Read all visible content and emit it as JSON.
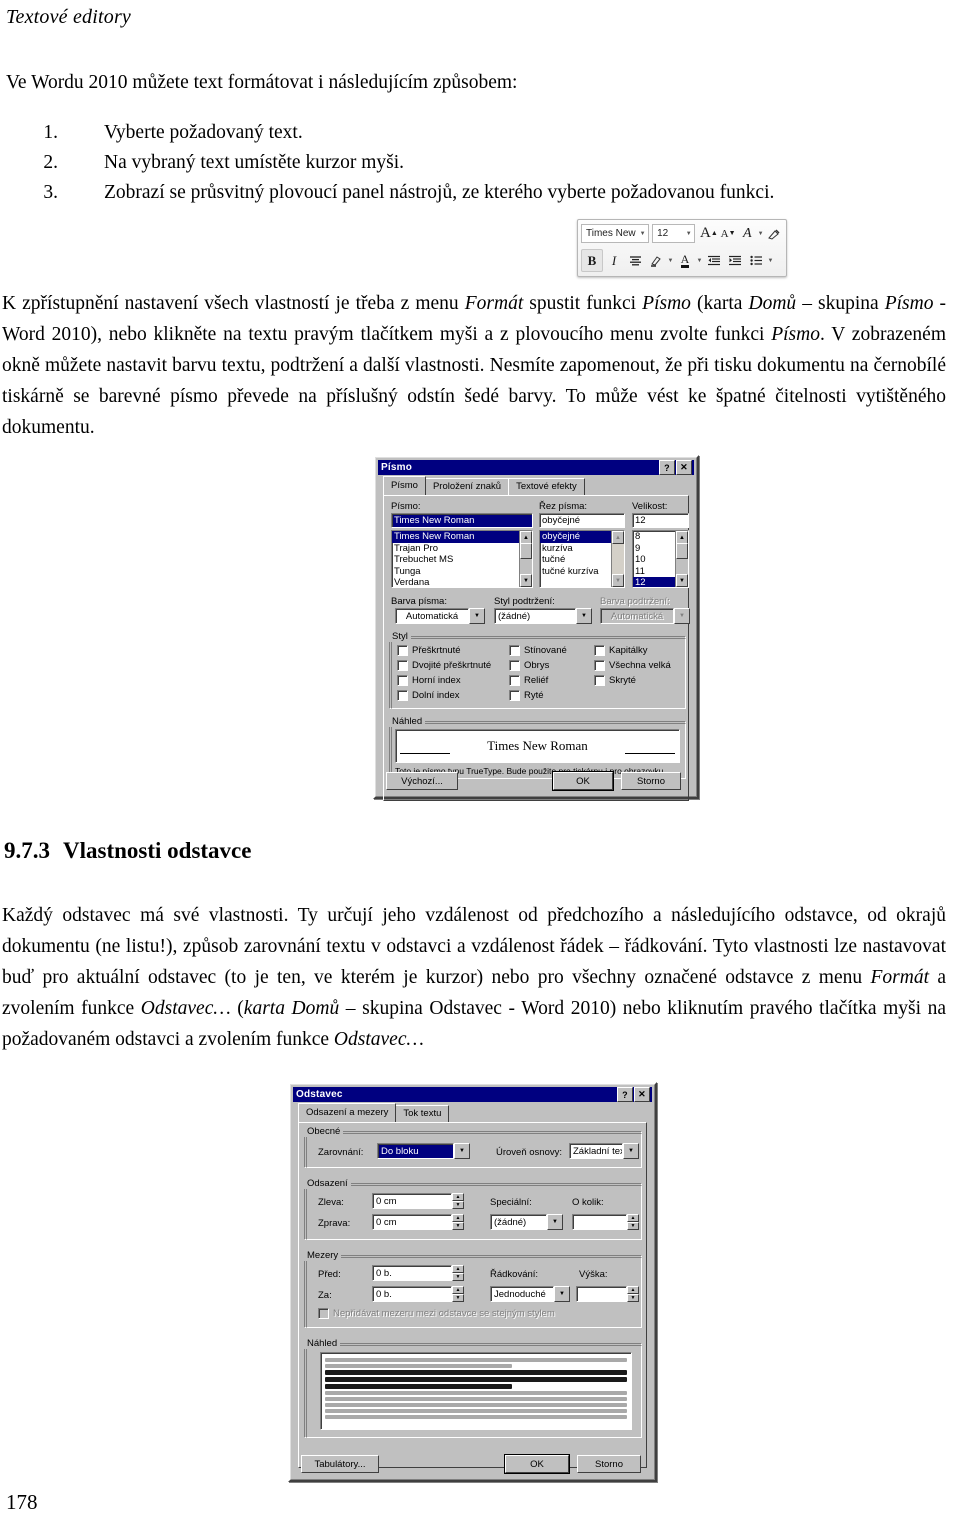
{
  "page": {
    "running_head": "Textové editory",
    "page_number": "178"
  },
  "body": {
    "intro": "Ve Wordu 2010 můžete text formátovat i následujícím způsobem:",
    "list": [
      {
        "num": "1.",
        "text": "Vyberte požadovaný text."
      },
      {
        "num": "2.",
        "text": "Na vybraný text umístěte kurzor myši."
      },
      {
        "num": "3.",
        "text": "Zobrazí se průsvitný plovoucí panel nástrojů, ze kterého vyberte požadovanou funkci."
      }
    ],
    "paragraph_font": {
      "s1": "K zpřístupnění nastavení všech vlastností je třeba z menu ",
      "i1": "Formát",
      "s2": " spustit funkci ",
      "i2": "Písmo",
      "s3": " (karta ",
      "i3": "Domů",
      "s4": " – skupina ",
      "i4": "Písmo",
      "s5": " - Word 2010), nebo klikněte na textu pravým tlačítkem myši a z plovoucího menu zvolte funkci ",
      "i5": "Písmo",
      "s6": ". V zobrazeném okně můžete nastavit barvu textu, podtržení a další vlastnosti. Nesmíte zapomenout, že při tisku dokumentu na černobílé tiskárně se barevné písmo převede na příslušný odstín šedé barvy. To může vést ke špatné čitelnosti vytištěného dokumentu."
    },
    "heading": {
      "number": "9.7.3",
      "title": "Vlastnosti odstavce"
    },
    "paragraph_para": {
      "s1": "Každý odstavec má své vlastnosti. Ty určují jeho vzdálenost od předchozího a následujícího odstavce, od okrajů dokumentu (ne listu!), způsob zarovnání textu v odstavci a vzdálenost řádek – řádkování. Tyto vlastnosti lze nastavovat buď pro aktuální odstavec (to je ten, ve kterém je kurzor) nebo pro všechny označené odstavce z menu ",
      "i1": "Formát",
      "s2": " a zvolením funkce ",
      "i2": "Odstavec…",
      "s3": " (",
      "i3": "karta Domů",
      "s4": " – skupina Odstavec - Word 2010) nebo kliknutím pravého tlačítka myši na požadovaném odstavci a zvolením funkce ",
      "i4": "Odstavec…",
      "s5": ""
    }
  },
  "minibar": {
    "font_name": "Times New",
    "font_size": "12",
    "grow_font_icon": "grow-font-icon",
    "shrink_font_icon": "shrink-font-icon",
    "clear_format_icon": "clear-formatting-icon",
    "format_painter_icon": "format-painter-icon",
    "bold": "B",
    "italic": "I",
    "align_icon": "center-align-icon",
    "highlight_icon": "highlight-icon",
    "font_color": "A",
    "decrease_indent_icon": "decrease-indent-icon",
    "increase_indent_icon": "increase-indent-icon",
    "bullets_icon": "bullets-icon",
    "dropdown_arrow": "▼"
  },
  "font_dialog": {
    "title": "Písmo",
    "help_button": "?",
    "close_button": "✕",
    "tabs": [
      {
        "label": "Písmo",
        "selected": true
      },
      {
        "label": "Proložení znaků",
        "selected": false
      },
      {
        "label": "Textové efekty",
        "selected": false
      }
    ],
    "font_label": "Písmo:",
    "font_value": "Times New Roman",
    "font_list": [
      "Times New Roman",
      "Trajan Pro",
      "Trebuchet MS",
      "Tunga",
      "Verdana"
    ],
    "style_label": "Řez písma:",
    "style_value": "obyčejné",
    "style_list": [
      "obyčejné",
      "kurzíva",
      "tučné",
      "tučné kurzíva"
    ],
    "size_label": "Velikost:",
    "size_value": "12",
    "size_list": [
      "8",
      "9",
      "10",
      "11",
      "12"
    ],
    "font_color_label": "Barva písma:",
    "font_color_value": "Automatická",
    "underline_style_label": "Styl podtržení:",
    "underline_style_value": "(žádné)",
    "underline_color_label": "Barva podtržení:",
    "underline_color_value": "Automatická",
    "effects_group": "Styl",
    "effects_col1": [
      "Přeškrtnuté",
      "Dvojité přeškrtnuté",
      "Horní index",
      "Dolní index"
    ],
    "effects_col2": [
      "Stínované",
      "Obrys",
      "Reliéf",
      "Ryté"
    ],
    "effects_col3": [
      "Kapitálky",
      "Všechna velká",
      "Skryté"
    ],
    "preview_group": "Náhled",
    "preview_text": "Times New Roman",
    "hint": "Toto je písmo typu TrueType. Bude použito pro tiskárnu i pro obrazovku.",
    "default_button": "Výchozí...",
    "ok_button": "OK",
    "cancel_button": "Storno"
  },
  "paragraph_dialog": {
    "title": "Odstavec",
    "help_button": "?",
    "close_button": "✕",
    "tabs": [
      {
        "label": "Odsazení a mezery",
        "selected": true
      },
      {
        "label": "Tok textu",
        "selected": false
      }
    ],
    "general_group": "Obecné",
    "alignment_label": "Zarovnání:",
    "alignment_value": "Do bloku",
    "outline_label": "Úroveň osnovy:",
    "outline_value": "Základní text",
    "indent_group": "Odsazení",
    "left_label": "Zleva:",
    "left_value": "0 cm",
    "right_label": "Zprava:",
    "right_value": "0 cm",
    "special_label": "Speciální:",
    "special_value": "(žádné)",
    "by_label": "O kolik:",
    "by_value": "",
    "spacing_group": "Mezery",
    "before_label": "Před:",
    "before_value": "0 b.",
    "after_label": "Za:",
    "after_value": "0 b.",
    "linespacing_label": "Řádkování:",
    "linespacing_value": "Jednoduché",
    "at_label": "Výška:",
    "at_value": "",
    "nospace_checkbox": "Nepřidávat mezeru mezi odstavce se stejným stylem",
    "preview_group": "Náhled",
    "tabs_button": "Tabulátory...",
    "ok_button": "OK",
    "cancel_button": "Storno"
  }
}
